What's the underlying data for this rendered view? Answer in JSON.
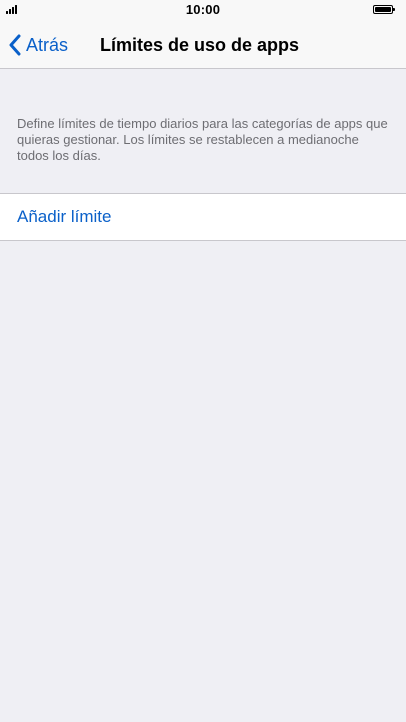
{
  "status_bar": {
    "time": "10:00",
    "signal_icon": "cellular-signal-icon",
    "battery_icon": "battery-icon",
    "battery_level": 1.0
  },
  "nav": {
    "back_label": "Atrás",
    "back_icon": "chevron-left-icon",
    "title": "Límites de uso de apps",
    "accent_color": "#0a60c9"
  },
  "main": {
    "description": "Define límites de tiempo diarios para las categorías de apps que quieras gestionar. Los límites se restablecen a medianoche todos los días.",
    "add_limit_label": "Añadir límite"
  }
}
